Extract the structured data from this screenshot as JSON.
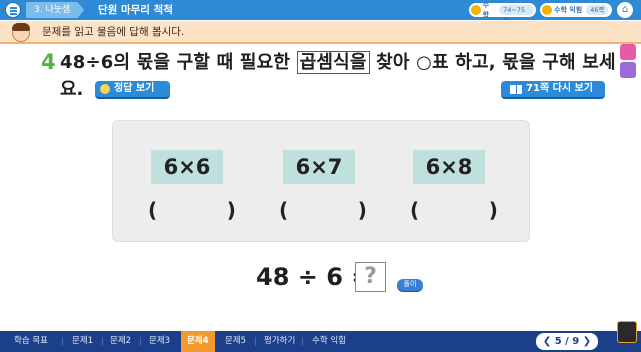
{
  "header": {
    "unit": "3. 나눗셈",
    "title": "단원 마무리 척척",
    "course": {
      "label": "수학",
      "pages": "74~75쪽"
    },
    "workbook": {
      "label": "수학 익힘",
      "pages": "46쪽"
    }
  },
  "instruction": "문제를 읽고 물음에 답해 봅시다.",
  "question": {
    "number": "4",
    "text_before": "48÷6의 몫을 구할 때 필요한 ",
    "highlight": "곱셈식을",
    "text_after": " 찾아 ○표 하고, 몫을 구해 보세",
    "line2": "요.",
    "answer_button": "정답 보기",
    "review_button": "71쪽 다시 보기"
  },
  "options": [
    {
      "expr": "6×6",
      "paren": "(          )"
    },
    {
      "expr": "6×7",
      "paren": "(          )"
    },
    {
      "expr": "6×8",
      "paren": "(          )"
    }
  ],
  "equation": {
    "text": "48 ÷ 6 =",
    "placeholder": "?",
    "solve_button": "풀이"
  },
  "bottom_nav": {
    "items": [
      "학습 목표",
      "문제1",
      "문제2",
      "문제3",
      "문제4",
      "문제5",
      "평가하기",
      "수학 익힘"
    ],
    "active_index": 4,
    "page": "5 / 9"
  },
  "colors": {
    "topbar": "#2f8ad6",
    "instruction_bg": "#fde3c6",
    "question_number": "#56b045",
    "highlight_border": "#e02020",
    "option_bg": "#bfe0dc",
    "bottom_nav": "#1c3f8a",
    "active_tab": "#f29a2e"
  }
}
